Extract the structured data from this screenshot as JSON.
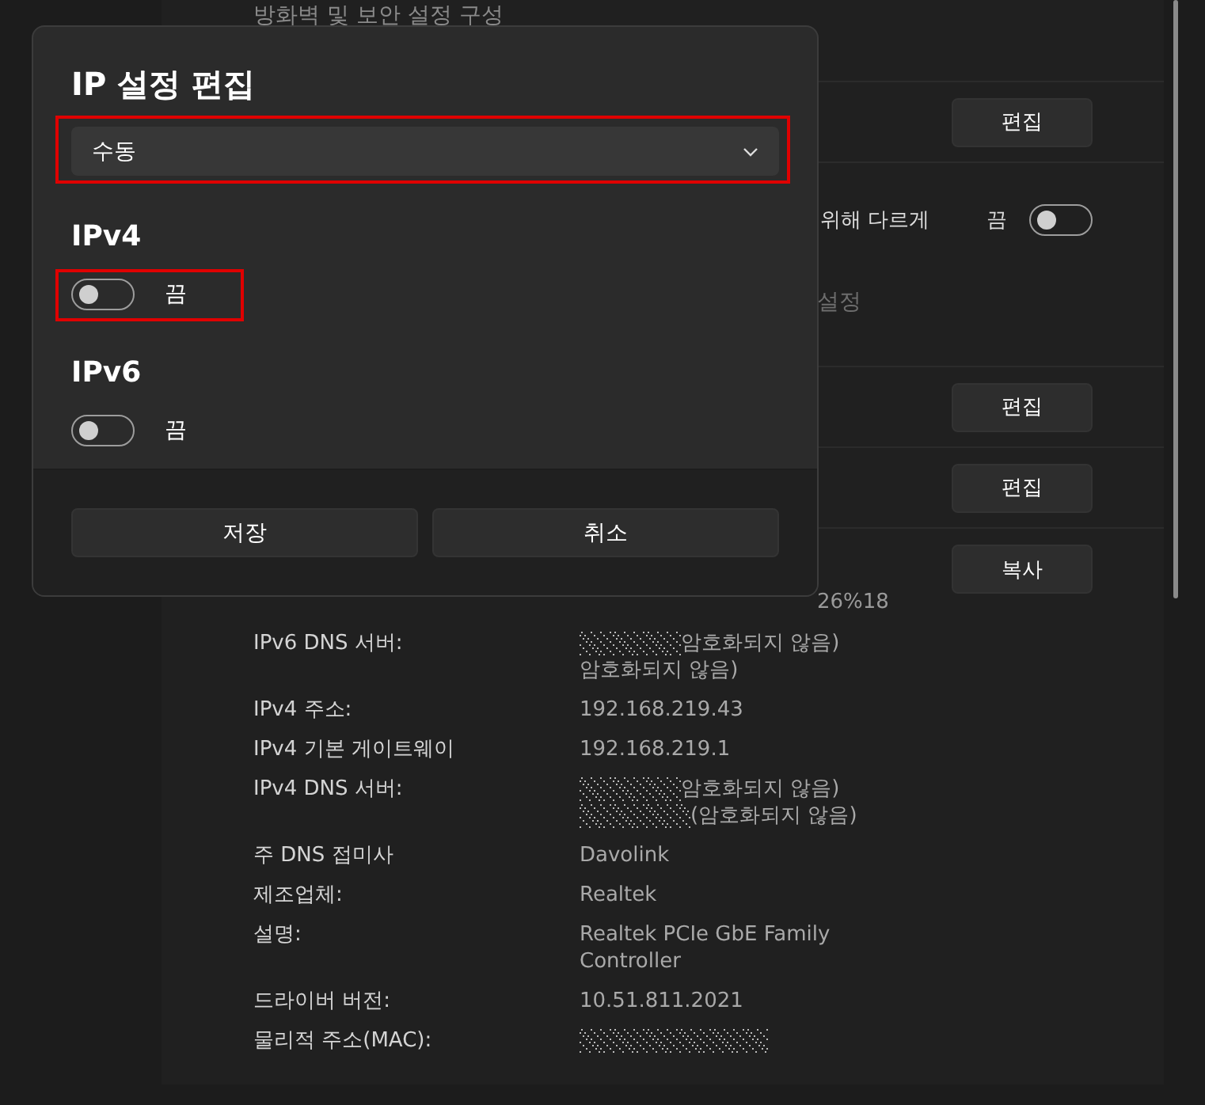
{
  "settings": {
    "heading_fragment": "방화벽 및 보안 설정 구성",
    "rows": [
      {
        "kind": "button",
        "button": "편집"
      },
      {
        "kind": "toggle",
        "text": "위해 다르게",
        "state_label": "끔",
        "on": false,
        "link": "설정"
      },
      {
        "kind": "button",
        "button": "편집"
      },
      {
        "kind": "button",
        "button": "편집"
      }
    ],
    "properties": {
      "button": "복사",
      "fragment": "26%18",
      "items": [
        {
          "label": "IPv6 DNS 서버:",
          "values": [
            {
              "text": "암호화되지 않음)",
              "redacted": true
            },
            {
              "text": "암호화되지 않음)",
              "redacted": false
            }
          ]
        },
        {
          "label": "IPv4 주소:",
          "values": [
            {
              "text": "192.168.219.43",
              "redacted": false
            }
          ]
        },
        {
          "label": "IPv4 기본 게이트웨이",
          "values": [
            {
              "text": "192.168.219.1",
              "redacted": false
            }
          ]
        },
        {
          "label": "IPv4 DNS 서버:",
          "values": [
            {
              "text": "암호화되지 않음)",
              "redacted": true
            },
            {
              "text": "(암호화되지 않음)",
              "redacted": true
            }
          ]
        },
        {
          "label": "주 DNS 접미사",
          "values": [
            {
              "text": "Davolink",
              "redacted": false
            }
          ]
        },
        {
          "label": "제조업체:",
          "values": [
            {
              "text": "Realtek",
              "redacted": false
            }
          ]
        },
        {
          "label": "설명:",
          "values": [
            {
              "text": "Realtek PCIe GbE Family",
              "redacted": false
            },
            {
              "text": "Controller",
              "redacted": false
            }
          ]
        },
        {
          "label": "드라이버 버전:",
          "values": [
            {
              "text": "10.51.811.2021",
              "redacted": false
            }
          ]
        },
        {
          "label": "물리적 주소(MAC):",
          "values": [
            {
              "redacted": true
            }
          ]
        }
      ]
    }
  },
  "dialog": {
    "title": "IP 설정 편집",
    "mode": {
      "value": "수동",
      "highlighted": true
    },
    "sections": [
      {
        "title": "IPv4",
        "toggle": {
          "on": false,
          "label": "끔",
          "highlighted": true
        }
      },
      {
        "title": "IPv6",
        "toggle": {
          "on": false,
          "label": "끔",
          "highlighted": false
        }
      }
    ],
    "buttons": [
      {
        "label": "저장"
      },
      {
        "label": "취소"
      }
    ]
  }
}
